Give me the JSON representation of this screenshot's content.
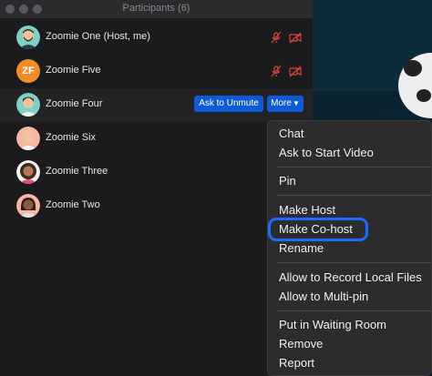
{
  "window": {
    "title": "Participants (6)"
  },
  "participants": [
    {
      "name": "Zoomie One (Host, me)",
      "avatar": "avatar-man-beard",
      "icons": [
        "muted-mic-icon",
        "video-off-icon"
      ]
    },
    {
      "name": "Zoomie Five",
      "avatar": "initials",
      "initials": "ZF",
      "icons": [
        "muted-mic-icon",
        "video-off-icon"
      ]
    },
    {
      "name": "Zoomie Four",
      "avatar": "avatar-man",
      "buttons": {
        "unmute": "Ask to Unmute",
        "more": "More"
      }
    },
    {
      "name": "Zoomie Six",
      "avatar": "avatar-woman-bald"
    },
    {
      "name": "Zoomie Three",
      "avatar": "avatar-woman-curly"
    },
    {
      "name": "Zoomie Two",
      "avatar": "avatar-woman-dark"
    }
  ],
  "menu": {
    "items": [
      "Chat",
      "Ask to Start Video",
      "Pin",
      "Make Host",
      "Make Co-host",
      "Rename",
      "Allow to Record Local Files",
      "Allow to Multi-pin",
      "Put in Waiting Room",
      "Remove",
      "Report"
    ],
    "highlighted": "Make Co-host"
  },
  "colors": {
    "accent": "#0e5ad4",
    "highlight_ring": "#1f6bff",
    "muted_icon": "#d9463a"
  }
}
